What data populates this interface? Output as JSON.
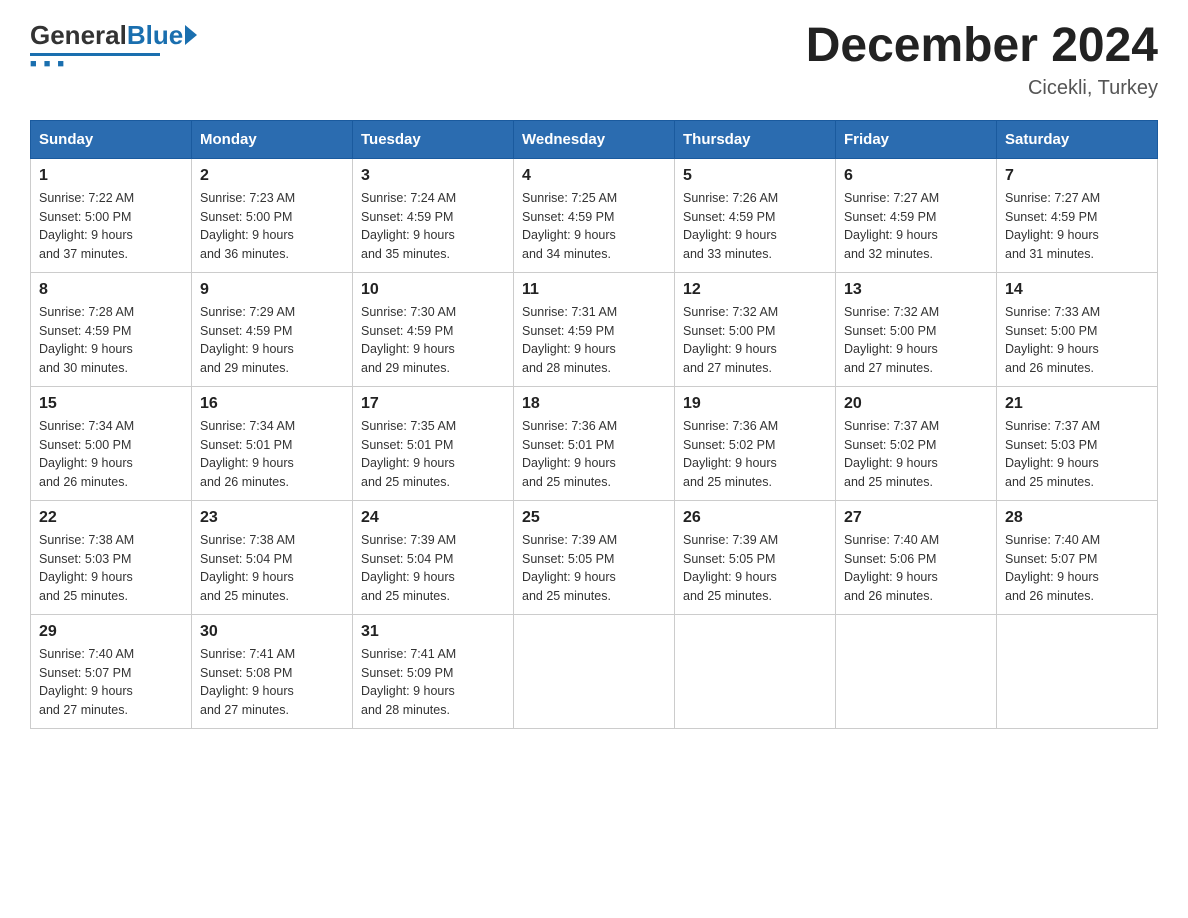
{
  "header": {
    "logo": {
      "general": "General",
      "blue": "Blue"
    },
    "title": "December 2024",
    "location": "Cicekli, Turkey"
  },
  "calendar": {
    "days_of_week": [
      "Sunday",
      "Monday",
      "Tuesday",
      "Wednesday",
      "Thursday",
      "Friday",
      "Saturday"
    ],
    "weeks": [
      [
        {
          "day": "1",
          "sunrise": "7:22 AM",
          "sunset": "5:00 PM",
          "daylight": "9 hours and 37 minutes."
        },
        {
          "day": "2",
          "sunrise": "7:23 AM",
          "sunset": "5:00 PM",
          "daylight": "9 hours and 36 minutes."
        },
        {
          "day": "3",
          "sunrise": "7:24 AM",
          "sunset": "4:59 PM",
          "daylight": "9 hours and 35 minutes."
        },
        {
          "day": "4",
          "sunrise": "7:25 AM",
          "sunset": "4:59 PM",
          "daylight": "9 hours and 34 minutes."
        },
        {
          "day": "5",
          "sunrise": "7:26 AM",
          "sunset": "4:59 PM",
          "daylight": "9 hours and 33 minutes."
        },
        {
          "day": "6",
          "sunrise": "7:27 AM",
          "sunset": "4:59 PM",
          "daylight": "9 hours and 32 minutes."
        },
        {
          "day": "7",
          "sunrise": "7:27 AM",
          "sunset": "4:59 PM",
          "daylight": "9 hours and 31 minutes."
        }
      ],
      [
        {
          "day": "8",
          "sunrise": "7:28 AM",
          "sunset": "4:59 PM",
          "daylight": "9 hours and 30 minutes."
        },
        {
          "day": "9",
          "sunrise": "7:29 AM",
          "sunset": "4:59 PM",
          "daylight": "9 hours and 29 minutes."
        },
        {
          "day": "10",
          "sunrise": "7:30 AM",
          "sunset": "4:59 PM",
          "daylight": "9 hours and 29 minutes."
        },
        {
          "day": "11",
          "sunrise": "7:31 AM",
          "sunset": "4:59 PM",
          "daylight": "9 hours and 28 minutes."
        },
        {
          "day": "12",
          "sunrise": "7:32 AM",
          "sunset": "5:00 PM",
          "daylight": "9 hours and 27 minutes."
        },
        {
          "day": "13",
          "sunrise": "7:32 AM",
          "sunset": "5:00 PM",
          "daylight": "9 hours and 27 minutes."
        },
        {
          "day": "14",
          "sunrise": "7:33 AM",
          "sunset": "5:00 PM",
          "daylight": "9 hours and 26 minutes."
        }
      ],
      [
        {
          "day": "15",
          "sunrise": "7:34 AM",
          "sunset": "5:00 PM",
          "daylight": "9 hours and 26 minutes."
        },
        {
          "day": "16",
          "sunrise": "7:34 AM",
          "sunset": "5:01 PM",
          "daylight": "9 hours and 26 minutes."
        },
        {
          "day": "17",
          "sunrise": "7:35 AM",
          "sunset": "5:01 PM",
          "daylight": "9 hours and 25 minutes."
        },
        {
          "day": "18",
          "sunrise": "7:36 AM",
          "sunset": "5:01 PM",
          "daylight": "9 hours and 25 minutes."
        },
        {
          "day": "19",
          "sunrise": "7:36 AM",
          "sunset": "5:02 PM",
          "daylight": "9 hours and 25 minutes."
        },
        {
          "day": "20",
          "sunrise": "7:37 AM",
          "sunset": "5:02 PM",
          "daylight": "9 hours and 25 minutes."
        },
        {
          "day": "21",
          "sunrise": "7:37 AM",
          "sunset": "5:03 PM",
          "daylight": "9 hours and 25 minutes."
        }
      ],
      [
        {
          "day": "22",
          "sunrise": "7:38 AM",
          "sunset": "5:03 PM",
          "daylight": "9 hours and 25 minutes."
        },
        {
          "day": "23",
          "sunrise": "7:38 AM",
          "sunset": "5:04 PM",
          "daylight": "9 hours and 25 minutes."
        },
        {
          "day": "24",
          "sunrise": "7:39 AM",
          "sunset": "5:04 PM",
          "daylight": "9 hours and 25 minutes."
        },
        {
          "day": "25",
          "sunrise": "7:39 AM",
          "sunset": "5:05 PM",
          "daylight": "9 hours and 25 minutes."
        },
        {
          "day": "26",
          "sunrise": "7:39 AM",
          "sunset": "5:05 PM",
          "daylight": "9 hours and 25 minutes."
        },
        {
          "day": "27",
          "sunrise": "7:40 AM",
          "sunset": "5:06 PM",
          "daylight": "9 hours and 26 minutes."
        },
        {
          "day": "28",
          "sunrise": "7:40 AM",
          "sunset": "5:07 PM",
          "daylight": "9 hours and 26 minutes."
        }
      ],
      [
        {
          "day": "29",
          "sunrise": "7:40 AM",
          "sunset": "5:07 PM",
          "daylight": "9 hours and 27 minutes."
        },
        {
          "day": "30",
          "sunrise": "7:41 AM",
          "sunset": "5:08 PM",
          "daylight": "9 hours and 27 minutes."
        },
        {
          "day": "31",
          "sunrise": "7:41 AM",
          "sunset": "5:09 PM",
          "daylight": "9 hours and 28 minutes."
        },
        null,
        null,
        null,
        null
      ]
    ]
  }
}
